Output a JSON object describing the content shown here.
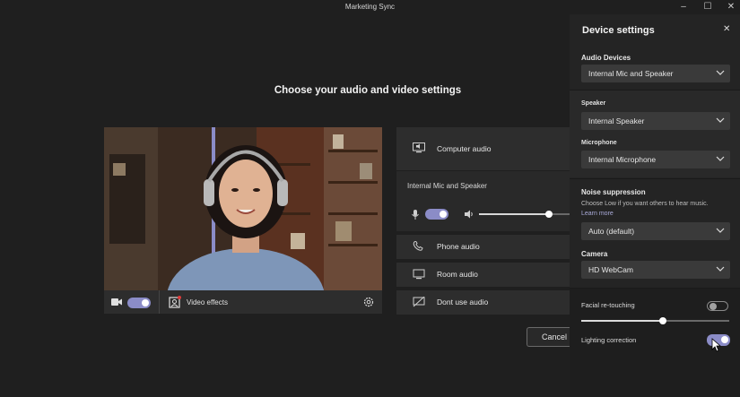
{
  "window": {
    "title": "Marketing Sync"
  },
  "main": {
    "heading": "Choose your audio and video settings",
    "video_effects_label": "Video effects",
    "audio_options": {
      "computer_audio": "Computer audio",
      "device_label": "Internal Mic and Speaker",
      "phone_audio": "Phone audio",
      "room_audio": "Room audio",
      "dont_use_audio": "Dont use audio"
    },
    "volume_level": 0.77,
    "cancel_label": "Cancel"
  },
  "device_settings": {
    "title": "Device settings",
    "audio_devices_label": "Audio Devices",
    "audio_devices_value": "Internal Mic and Speaker",
    "speaker_label": "Speaker",
    "speaker_value": "Internal Speaker",
    "microphone_label": "Microphone",
    "microphone_value": "Internal Microphone",
    "noise_label": "Noise suppression",
    "noise_hint": "Choose Low if you want others to hear music.",
    "learn_more": "Learn more",
    "noise_value": "Auto (default)",
    "camera_label": "Camera",
    "camera_value": "HD WebCam",
    "facial_label": "Facial re-touching",
    "facial_on": false,
    "facial_level": 0.55,
    "lighting_label": "Lighting correction",
    "lighting_on": true
  },
  "colors": {
    "accent": "#8b8cc7",
    "panel": "#242424",
    "background": "#1f1f1f"
  }
}
